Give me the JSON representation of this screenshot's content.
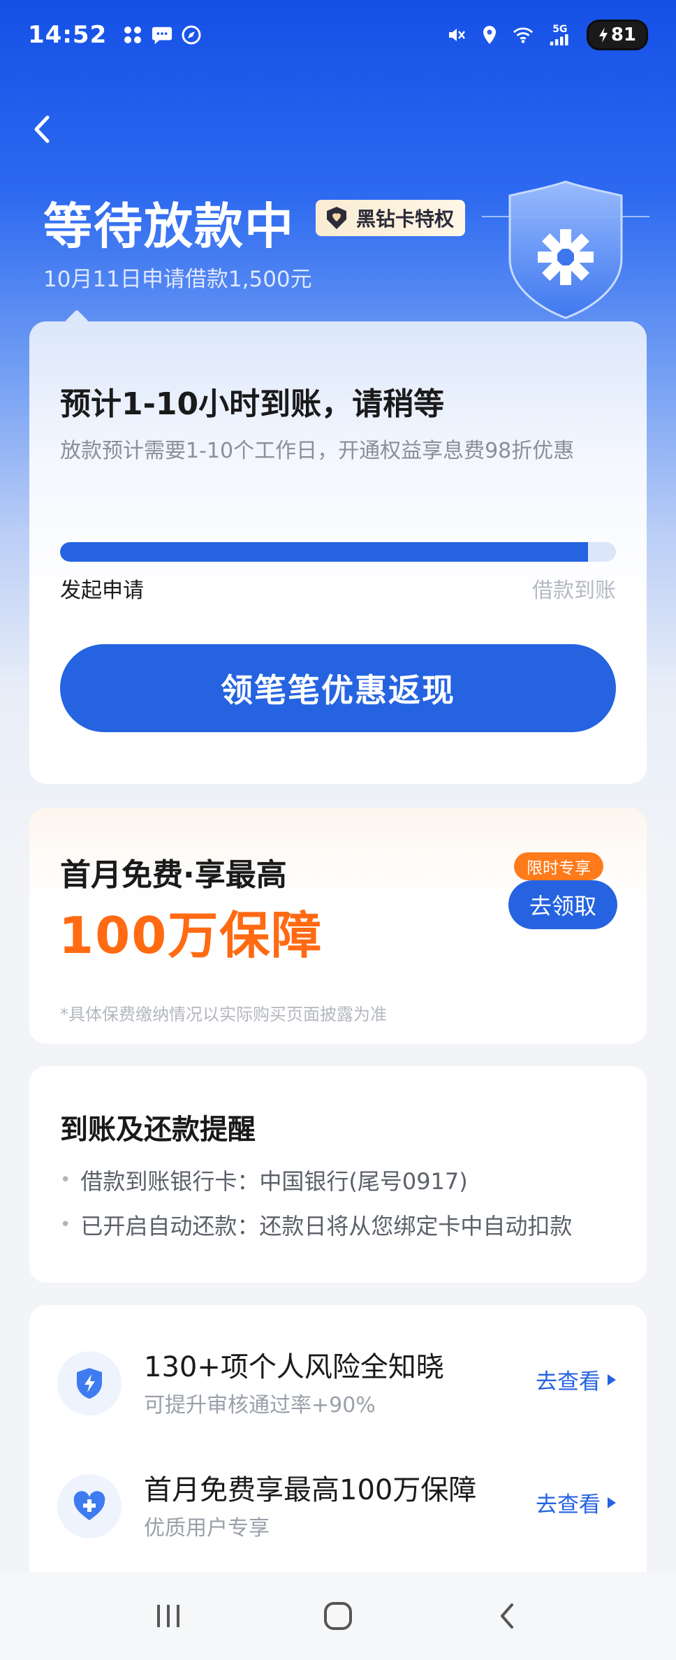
{
  "status_bar": {
    "time": "14:52",
    "network": "5G",
    "battery": "81"
  },
  "header": {
    "title": "等待放款中",
    "vip_badge": "黑钻卡特权",
    "subtitle": "10月11日申请借款1,500元"
  },
  "status_card": {
    "heading": "预计1-10小时到账，请稍等",
    "description": "放款预计需要1-10个工作日，开通权益享息费98折优惠",
    "progress_fraction": 0.95,
    "progress_start_label": "发起申请",
    "progress_end_label": "借款到账",
    "cta_label": "领笔笔优惠返现"
  },
  "insurance_card": {
    "title": "首月免费·享最高",
    "amount": "100万保障",
    "tag": "限时专享",
    "button": "去领取",
    "note": "*具体保费缴纳情况以实际购买页面披露为准"
  },
  "reminder_card": {
    "title": "到账及还款提醒",
    "items": [
      "借款到账银行卡：中国银行(尾号0917)",
      "已开启自动还款：还款日将从您绑定卡中自动扣款"
    ]
  },
  "services": [
    {
      "title": "130+项个人风险全知晓",
      "subtitle": "可提升审核通过率+90%",
      "link": "去查看",
      "icon": "shield-bolt-icon"
    },
    {
      "title": "首月免费享最高100万保障",
      "subtitle": "优质用户专享",
      "link": "去查看",
      "icon": "heart-plus-icon"
    }
  ],
  "colors": {
    "primary": "#2563e0",
    "accent_orange": "#ff6a13",
    "header_blue": "#1550e6"
  }
}
